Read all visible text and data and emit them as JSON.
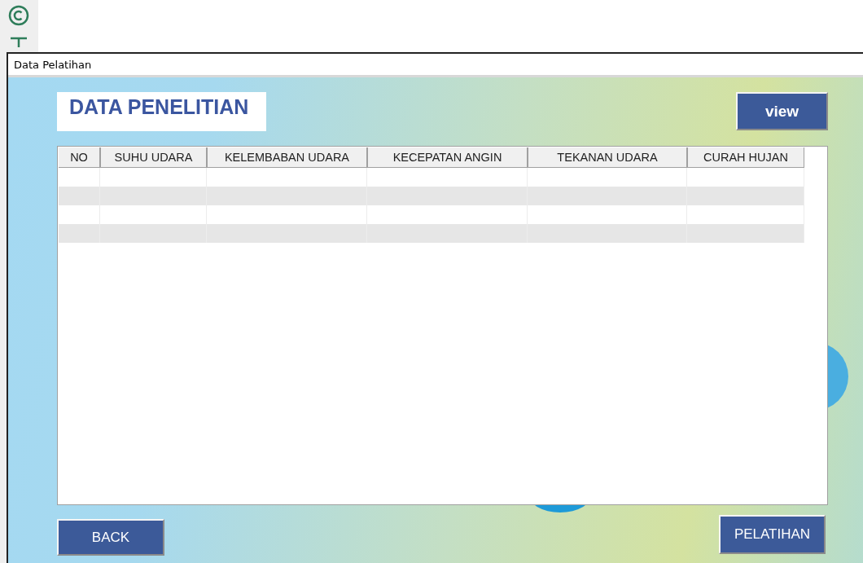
{
  "window": {
    "title": "Data Pelatihan"
  },
  "heading": "DATA PENELITIAN",
  "view_button": "view",
  "table": {
    "columns": [
      "NO",
      "SUHU UDARA",
      "KELEMBABAN UDARA",
      "KECEPATAN ANGIN",
      "TEKANAN UDARA",
      "CURAH HUJAN"
    ],
    "rows": [
      {
        "striped": false
      },
      {
        "striped": true
      },
      {
        "striped": false
      },
      {
        "striped": true
      }
    ]
  },
  "buttons": [
    "BACK",
    "PELATIHAN"
  ]
}
